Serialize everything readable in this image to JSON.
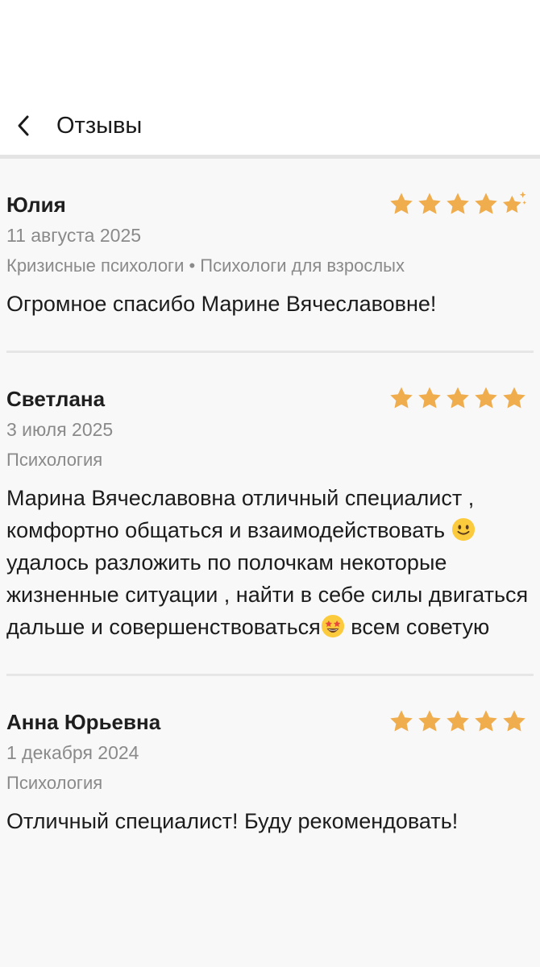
{
  "header": {
    "title": "Отзывы",
    "back_icon": "chevron-left-icon"
  },
  "colors": {
    "star": "#f0ad4e",
    "meta_text": "#8a8a8a",
    "divider": "#e6e6e6"
  },
  "reviews": [
    {
      "name": "Юлия",
      "date": "11 августа 2025",
      "category": "Кризисные психологи • Психологи для взрослых",
      "rating": 5,
      "rating_icon": "star-sparkle-icon",
      "text": "Огромное спасибо Марине Вячеславовне!"
    },
    {
      "name": "Светлана",
      "date": "3 июля 2025",
      "category": "Психология",
      "rating": 5,
      "text_part1": "Марина Вячеславовна отличный специалист , комфортно общаться и взаимодействовать ",
      "emoji1": "slightly-smiling-face-icon",
      "text_part2": " удалось разложить по полочкам некоторые жизненные ситуации , найти в себе силы двигаться дальше и совершенствоваться",
      "emoji2": "star-struck-face-icon",
      "text_part3": " всем советую"
    },
    {
      "name": "Анна Юрьевна",
      "date": "1 декабря 2024",
      "category": "Психология",
      "rating": 5,
      "text": "Отличный специалист! Буду рекомендовать!"
    }
  ]
}
